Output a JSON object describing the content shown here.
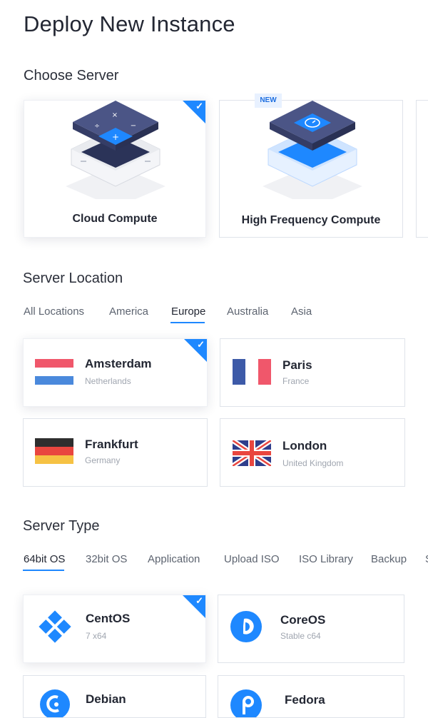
{
  "page": {
    "title": "Deploy New Instance"
  },
  "choose_server": {
    "heading": "Choose Server",
    "options": [
      {
        "label": "Cloud Compute",
        "selected": true
      },
      {
        "label": "High Frequency Compute",
        "badge": "NEW",
        "selected": false
      }
    ]
  },
  "server_location": {
    "heading": "Server Location",
    "tabs": [
      {
        "label": "All Locations",
        "active": false
      },
      {
        "label": "America",
        "active": false
      },
      {
        "label": "Europe",
        "active": true
      },
      {
        "label": "Australia",
        "active": false
      },
      {
        "label": "Asia",
        "active": false
      }
    ],
    "locations": [
      {
        "city": "Amsterdam",
        "country": "Netherlands",
        "flag": "netherlands-flag-icon",
        "selected": true
      },
      {
        "city": "Paris",
        "country": "France",
        "flag": "france-flag-icon",
        "selected": false
      },
      {
        "city": "Frankfurt",
        "country": "Germany",
        "flag": "germany-flag-icon",
        "selected": false
      },
      {
        "city": "London",
        "country": "United Kingdom",
        "flag": "uk-flag-icon",
        "selected": false
      }
    ]
  },
  "server_type": {
    "heading": "Server Type",
    "tabs": [
      {
        "label": "64bit OS",
        "active": true
      },
      {
        "label": "32bit OS",
        "active": false
      },
      {
        "label": "Application",
        "active": false
      },
      {
        "label": "Upload ISO",
        "active": false
      },
      {
        "label": "ISO Library",
        "active": false
      },
      {
        "label": "Backup",
        "active": false
      },
      {
        "label": "S",
        "active": false
      }
    ],
    "os_options": [
      {
        "name": "CentOS",
        "version": "7 x64",
        "icon": "centos-icon",
        "selected": true
      },
      {
        "name": "CoreOS",
        "version": "Stable c64",
        "icon": "coreos-icon",
        "selected": false
      },
      {
        "name": "Debian",
        "version": "",
        "icon": "debian-icon",
        "selected": false
      },
      {
        "name": "Fedora",
        "version": "",
        "icon": "fedora-icon",
        "selected": false
      }
    ]
  },
  "colors": {
    "accent": "#1e88ff",
    "text_dark": "#232733",
    "text_muted": "#a0a6b0",
    "border": "#dfe3ea"
  }
}
